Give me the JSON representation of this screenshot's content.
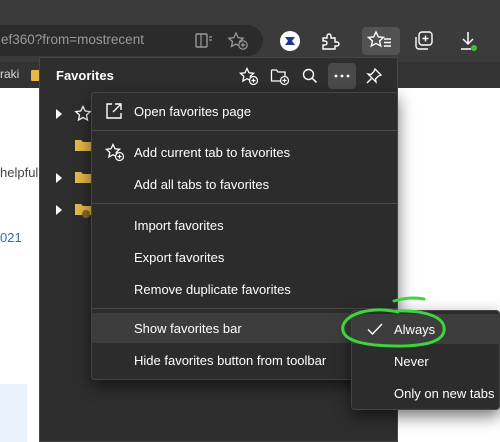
{
  "browser": {
    "url_fragment": "ef360?from=mostrecent",
    "icons": [
      "reader-view-icon",
      "add-favorite-icon",
      "extension-avatar-icon",
      "extensions-icon",
      "favorites-icon",
      "collections-icon",
      "downloads-icon"
    ]
  },
  "favorites_bar": {
    "partial_item": "raki"
  },
  "page": {
    "snippet_gray": "helpful",
    "snippet_blue": "021"
  },
  "favorites_panel": {
    "title": "Favorites",
    "header_icons": [
      "add-favorite-icon",
      "add-folder-icon",
      "search-icon",
      "more-options-icon",
      "pin-icon"
    ]
  },
  "menu": {
    "open_page": "Open favorites page",
    "add_current": "Add current tab to favorites",
    "add_all": "Add all tabs to favorites",
    "import": "Import favorites",
    "export": "Export favorites",
    "remove_duplicates": "Remove duplicate favorites",
    "show_bar": "Show favorites bar",
    "hide_button": "Hide favorites button from toolbar"
  },
  "submenu": {
    "selected": "Always",
    "options": [
      "Always",
      "Never",
      "Only on new tabs"
    ]
  },
  "colors": {
    "toolbar": "#3b3b3b",
    "panel": "#2e2e2e",
    "menu": "#2c2c2c",
    "highlight": "#3d3d3d",
    "folder": "#e8b84a",
    "annotation": "#3cd63c"
  }
}
